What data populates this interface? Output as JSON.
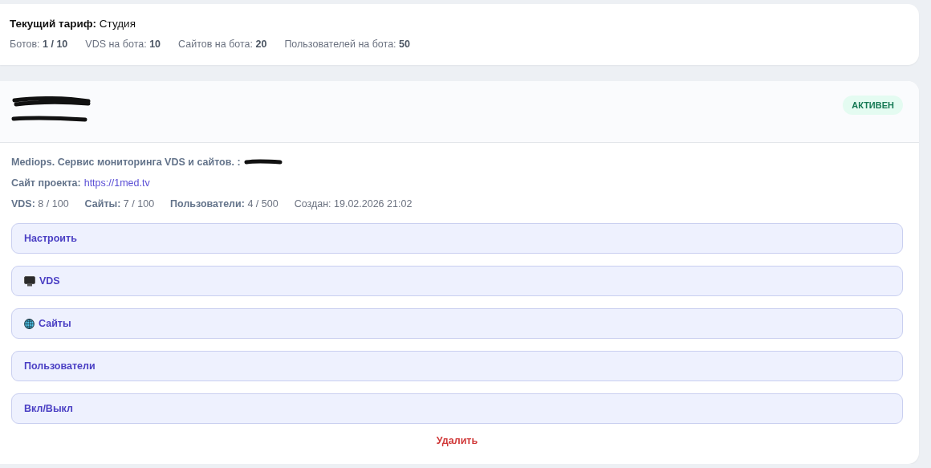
{
  "plan": {
    "label": "Текущий тариф:",
    "value": "Студия",
    "limits": [
      {
        "label": "Ботов:",
        "value": "1 / 10"
      },
      {
        "label": "VDS на бота:",
        "value": "10"
      },
      {
        "label": "Сайтов на бота:",
        "value": "20"
      },
      {
        "label": "Пользователей на бота:",
        "value": "50"
      }
    ]
  },
  "bot": {
    "status": "АКТИВЕН",
    "active": true,
    "description": "Mediops. Сервис мониторинга VDS и сайтов. :",
    "site_label": "Сайт проекта:",
    "site_url": "https://1med.tv",
    "stats": [
      {
        "label": "VDS:",
        "value": "8 / 100"
      },
      {
        "label": "Сайты:",
        "value": "7 / 100"
      },
      {
        "label": "Пользователи:",
        "value": "4 / 500"
      }
    ],
    "created": "Создан: 19.02.2026 21:02",
    "actions": [
      {
        "label": "Настроить",
        "kind": "plain"
      },
      {
        "label": "VDS",
        "kind": "monitor"
      },
      {
        "label": "Сайты",
        "kind": "globe"
      },
      {
        "label": "Пользователи",
        "kind": "plain"
      },
      {
        "label": "Вкл/Выкл",
        "kind": "plain"
      }
    ],
    "delete": "Удалить"
  }
}
